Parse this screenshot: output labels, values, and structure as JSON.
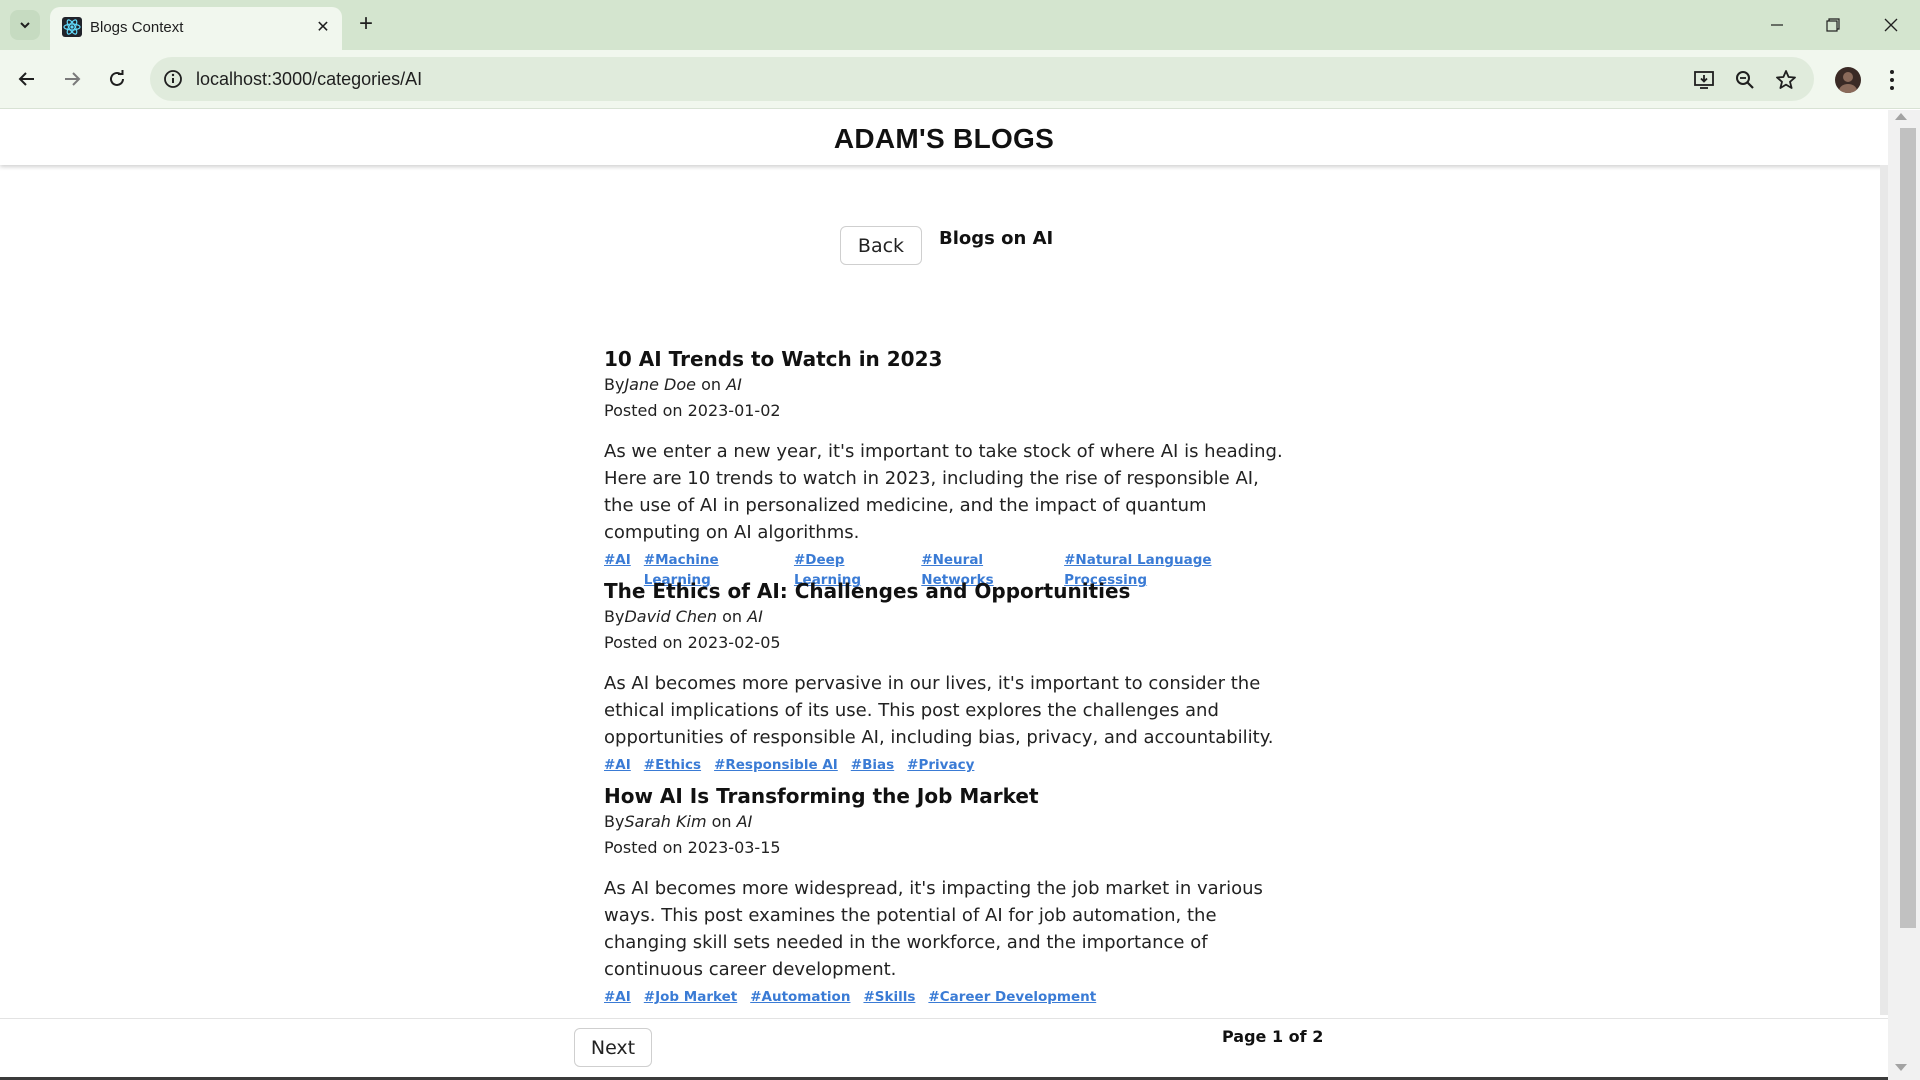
{
  "browser": {
    "tab_title": "Blogs Context",
    "url": "localhost:3000/categories/AI",
    "icons": [
      "tab-search-icon",
      "react-favicon-icon",
      "close-icon",
      "plus-icon",
      "minimize-icon",
      "restore-icon",
      "window-close-icon",
      "back-arrow-icon",
      "forward-arrow-icon",
      "reload-icon",
      "site-info-icon",
      "install-app-icon",
      "zoom-icon",
      "star-icon",
      "profile-avatar",
      "kebab-menu-icon"
    ]
  },
  "site": {
    "title": "ADAM'S BLOGS",
    "back_label": "Back",
    "heading": "Blogs on AI"
  },
  "posts": [
    {
      "title": "10 AI Trends to Watch in 2023",
      "by_label": "By",
      "author": "Jane Doe",
      "on_label": "on",
      "category": "AI",
      "date": "Posted on 2023-01-02",
      "body": "As we enter a new year, it's important to take stock of where AI is heading. Here are 10 trends to watch in 2023, including the rise of responsible AI, the use of AI in personalized medicine, and the impact of quantum computing on AI algorithms.",
      "tags": [
        "#AI",
        "#Machine Learning",
        "#Deep Learning",
        "#Neural Networks",
        "#Natural Language Processing"
      ]
    },
    {
      "title": "The Ethics of AI: Challenges and Opportunities",
      "by_label": "By",
      "author": "David Chen",
      "on_label": "on",
      "category": "AI",
      "date": "Posted on 2023-02-05",
      "body": "As AI becomes more pervasive in our lives, it's important to consider the ethical implications of its use. This post explores the challenges and opportunities of responsible AI, including bias, privacy, and accountability.",
      "tags": [
        "#AI",
        "#Ethics",
        "#Responsible AI",
        "#Bias",
        "#Privacy"
      ]
    },
    {
      "title": "How AI Is Transforming the Job Market",
      "by_label": "By",
      "author": "Sarah Kim",
      "on_label": "on",
      "category": "AI",
      "date": "Posted on 2023-03-15",
      "body": "As AI becomes more widespread, it's impacting the job market in various ways. This post examines the potential of AI for job automation, the changing skill sets needed in the workforce, and the importance of continuous career development.",
      "tags": [
        "#AI",
        "#Job Market",
        "#Automation",
        "#Skills",
        "#Career Development"
      ]
    }
  ],
  "pagination": {
    "next_label": "Next",
    "page_text": "Page 1 of 2"
  },
  "colors": {
    "chrome_tabbar": "#d4e5cf",
    "chrome_toolbar": "#f1f7ee",
    "tag_link": "#3a7bd5"
  }
}
